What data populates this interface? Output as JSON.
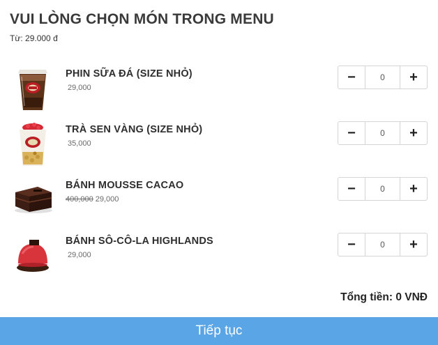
{
  "modal": {
    "title": "VUI LÒNG CHỌN MÓN TRONG MENU",
    "subtitle": "Từ: 29.000 đ"
  },
  "items": [
    {
      "name": "PHIN SỮA ĐÁ (SIZE NHỎ)",
      "old_price": "",
      "price": "29,000",
      "quantity": "0",
      "icon": "iced-coffee-cup-icon"
    },
    {
      "name": "TRÀ SEN VÀNG (SIZE NHỎ)",
      "old_price": "",
      "price": "35,000",
      "quantity": "0",
      "icon": "lotus-tea-cup-icon"
    },
    {
      "name": "BÁNH MOUSSE CACAO",
      "old_price": "400,000",
      "price": "29,000",
      "quantity": "0",
      "icon": "chocolate-cake-slice-icon"
    },
    {
      "name": "BÁNH SÔ-CÔ-LA HIGHLANDS",
      "old_price": "",
      "price": "29,000",
      "quantity": "0",
      "icon": "red-dome-cake-icon"
    }
  ],
  "stepper": {
    "minus_label": "−",
    "plus_label": "+"
  },
  "total": "Tổng tiền: 0 VNĐ",
  "continue_label": "Tiếp tục",
  "colors": {
    "button_blue": "#5aa5e6",
    "title_text": "#3a3a3a",
    "border": "#d4d4d4"
  }
}
